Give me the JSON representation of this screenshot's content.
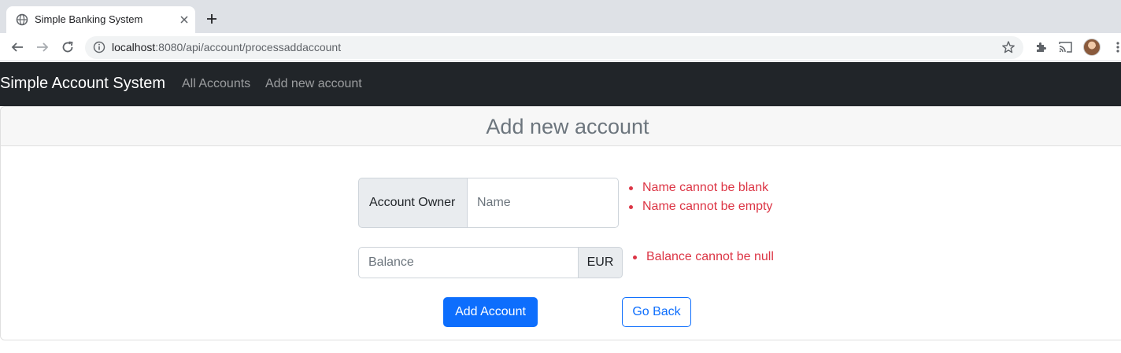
{
  "browser": {
    "tab_title": "Simple Banking System",
    "url_host": "localhost",
    "url_rest": ":8080/api/account/processaddaccount"
  },
  "navbar": {
    "brand": "Simple Account System",
    "links": [
      "All Accounts",
      "Add new account"
    ]
  },
  "form": {
    "title": "Add new account",
    "owner_label": "Account Owner",
    "owner_placeholder": "Name",
    "owner_errors": [
      "Name cannot be blank",
      "Name cannot be empty"
    ],
    "balance_placeholder": "Balance",
    "currency": "EUR",
    "balance_errors": [
      "Balance cannot be null"
    ],
    "submit_label": "Add Account",
    "back_label": "Go Back"
  },
  "colors": {
    "navbar_bg": "#212529",
    "primary": "#0d6efd",
    "error": "#dc3545"
  }
}
